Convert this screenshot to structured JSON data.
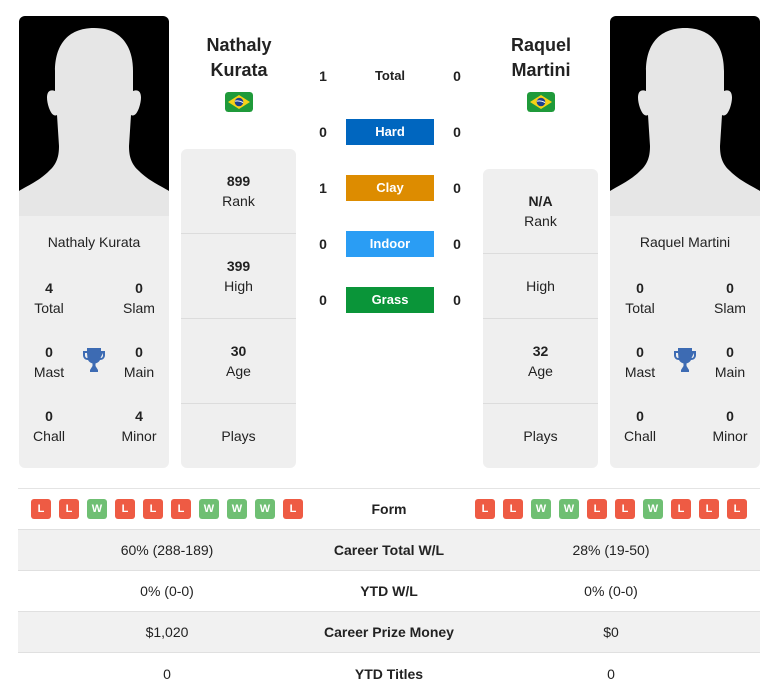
{
  "colors": {
    "hard": "#0066bf",
    "clay": "#dd8c00",
    "indoor": "#2a9df4",
    "grass": "#0a9539",
    "loss": "#ee5b44",
    "win": "#6fbf73",
    "trophy": "#3d6bb3"
  },
  "player1": {
    "name_line1": "Nathaly",
    "name_line2": "Kurata",
    "full_name": "Nathaly Kurata",
    "flag": "brazil-flag",
    "titles": {
      "total": {
        "value": "4",
        "label": "Total"
      },
      "slam": {
        "value": "0",
        "label": "Slam"
      },
      "mast": {
        "value": "0",
        "label": "Mast"
      },
      "main": {
        "value": "0",
        "label": "Main"
      },
      "chall": {
        "value": "0",
        "label": "Chall"
      },
      "minor": {
        "value": "4",
        "label": "Minor"
      }
    },
    "info": {
      "rank": {
        "value": "899",
        "label": "Rank"
      },
      "high": {
        "value": "399",
        "label": "High"
      },
      "age": {
        "value": "30",
        "label": "Age"
      },
      "plays": {
        "value": "",
        "label": "Plays"
      }
    },
    "form": [
      "L",
      "L",
      "W",
      "L",
      "L",
      "L",
      "W",
      "W",
      "W",
      "L"
    ]
  },
  "player2": {
    "name_line1": "Raquel",
    "name_line2": "Martini",
    "full_name": "Raquel Martini",
    "flag": "brazil-flag",
    "titles": {
      "total": {
        "value": "0",
        "label": "Total"
      },
      "slam": {
        "value": "0",
        "label": "Slam"
      },
      "mast": {
        "value": "0",
        "label": "Mast"
      },
      "main": {
        "value": "0",
        "label": "Main"
      },
      "chall": {
        "value": "0",
        "label": "Chall"
      },
      "minor": {
        "value": "0",
        "label": "Minor"
      }
    },
    "info": {
      "rank": {
        "value": "N/A",
        "label": "Rank"
      },
      "high": {
        "value": "",
        "label": "High"
      },
      "age": {
        "value": "32",
        "label": "Age"
      },
      "plays": {
        "value": "",
        "label": "Plays"
      }
    },
    "form": [
      "L",
      "L",
      "W",
      "W",
      "L",
      "L",
      "W",
      "L",
      "L",
      "L"
    ]
  },
  "h2h": [
    {
      "label": "Total",
      "p1": "1",
      "p2": "0"
    },
    {
      "label": "Hard",
      "p1": "0",
      "p2": "0"
    },
    {
      "label": "Clay",
      "p1": "1",
      "p2": "0"
    },
    {
      "label": "Indoor",
      "p1": "0",
      "p2": "0"
    },
    {
      "label": "Grass",
      "p1": "0",
      "p2": "0"
    }
  ],
  "stats": {
    "form_label": "Form",
    "rows": [
      {
        "label": "Career Total W/L",
        "p1": "60% (288-189)",
        "p2": "28% (19-50)"
      },
      {
        "label": "YTD W/L",
        "p1": "0% (0-0)",
        "p2": "0% (0-0)"
      },
      {
        "label": "Career Prize Money",
        "p1": "$1,020",
        "p2": "$0"
      },
      {
        "label": "YTD Titles",
        "p1": "0",
        "p2": "0"
      }
    ]
  }
}
